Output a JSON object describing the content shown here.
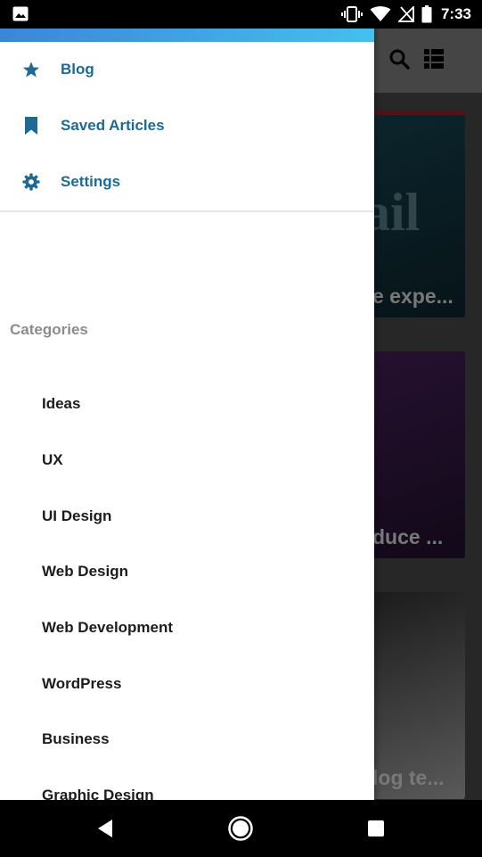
{
  "status_bar": {
    "time": "7:33",
    "icons": [
      "image-icon",
      "vibrate-icon",
      "wifi-icon",
      "no-signal-icon",
      "battery-icon"
    ]
  },
  "drawer": {
    "accent_gradient": [
      "#3a86d9",
      "#43c0f0"
    ],
    "nav_items": [
      {
        "icon": "star-icon",
        "label": "Blog"
      },
      {
        "icon": "bookmark-icon",
        "label": "Saved Articles"
      },
      {
        "icon": "gear-icon",
        "label": "Settings"
      }
    ],
    "categories_header": "Categories",
    "categories": [
      "Ideas",
      "UX",
      "UI Design",
      "Web Design",
      "Web Development",
      "WordPress",
      "Business",
      "Graphic Design"
    ]
  },
  "background_app": {
    "toolbar_icons": [
      "search-icon",
      "list-view-icon"
    ],
    "card_titles": [
      "e expe...",
      "duce ...",
      "log te..."
    ]
  },
  "nav_bar": {
    "icons": [
      "back-icon",
      "home-icon",
      "recents-icon"
    ]
  },
  "colors": {
    "nav_label": "#1e6a95",
    "category_header": "#8c8c8c"
  }
}
